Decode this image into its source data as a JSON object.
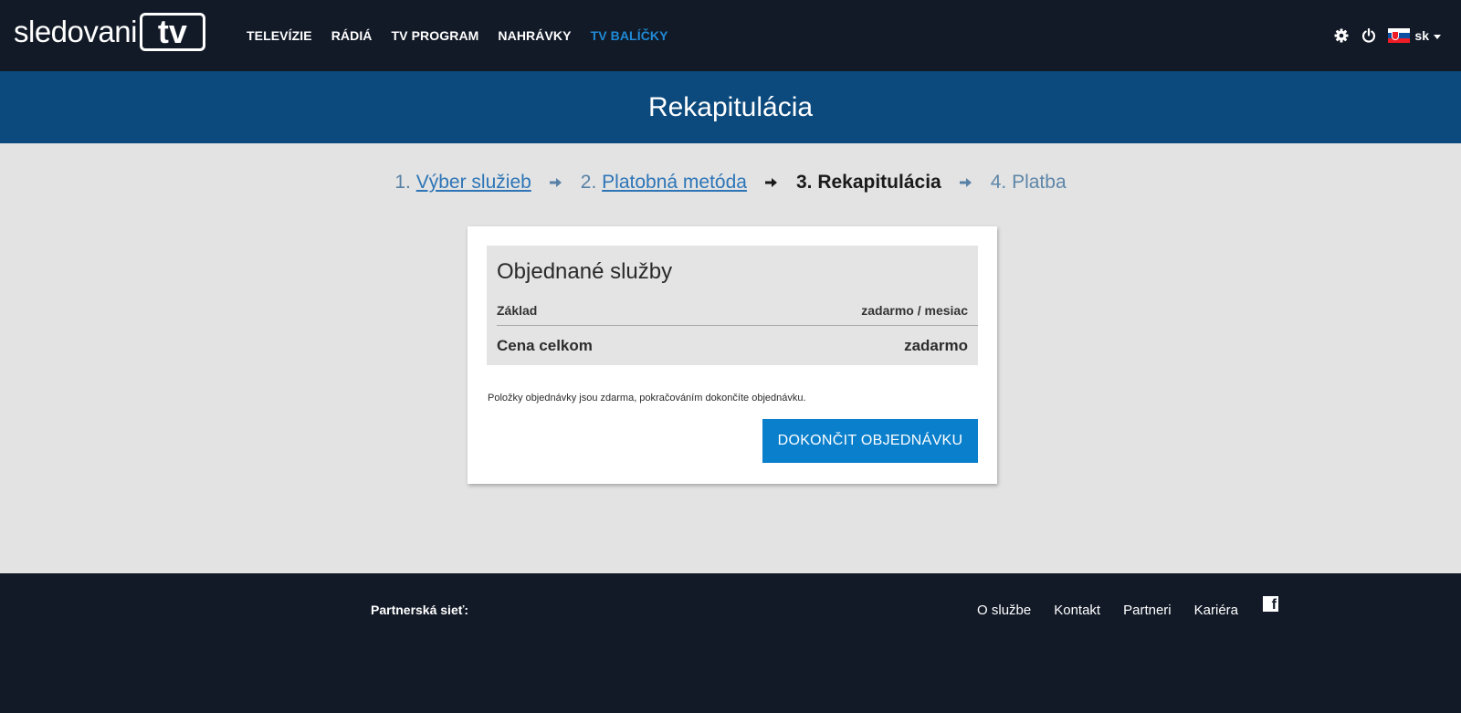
{
  "header": {
    "logo_text": "sledovani",
    "logo_box": "tv",
    "nav": [
      {
        "label": "TELEVÍZIE",
        "active": false
      },
      {
        "label": "RÁDIÁ",
        "active": false
      },
      {
        "label": "TV PROGRAM",
        "active": false
      },
      {
        "label": "NAHRÁVKY",
        "active": false
      },
      {
        "label": "TV BALÍČKY",
        "active": true
      }
    ],
    "settings_icon": "gear-icon",
    "power_icon": "power-icon",
    "language": "sk"
  },
  "page_title": "Rekapitulácia",
  "steps": [
    {
      "number": "1.",
      "label": "Výber služieb",
      "state": "link"
    },
    {
      "number": "2.",
      "label": "Platobná metóda",
      "state": "link"
    },
    {
      "number": "3.",
      "label": "Rekapitulácia",
      "state": "current"
    },
    {
      "number": "4.",
      "label": "Platba",
      "state": "future"
    }
  ],
  "order": {
    "heading": "Objednané služby",
    "item_name": "Základ",
    "item_price": "zadarmo / mesiac",
    "total_label": "Cena celkom",
    "total_value": "zadarmo",
    "note": "Položky objednávky jsou zdarma, pokračováním dokončíte objednávku.",
    "finish_button": "DOKONČIT OBJEDNÁVKU"
  },
  "footer": {
    "partner_label": "Partnerská sieť:",
    "links": [
      "O službe",
      "Kontakt",
      "Partneri",
      "Kariéra"
    ],
    "social_icon": "facebook-icon"
  },
  "colors": {
    "topbar": "#121a27",
    "title_band": "#0c4a7d",
    "accent": "#0a7fcc",
    "nav_active": "#1f8ad6"
  }
}
